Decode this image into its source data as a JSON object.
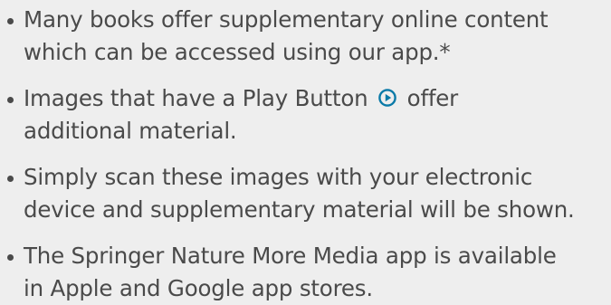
{
  "bullets": [
    {
      "line1": "Many books offer supplementary online content",
      "line2": "which can be accessed using our app.*"
    },
    {
      "line1_before_icon": "Images that have a Play Button",
      "line1_after_icon": "offer",
      "line2": "additional material.",
      "icon": "play-circle-icon",
      "icon_color": "#0a7aa8"
    },
    {
      "line1": "Simply scan these images with your electronic",
      "line2": "device and supplementary material will be shown."
    },
    {
      "line1": "The Springer Nature More Media app is available",
      "line2": "in Apple and Google app stores."
    }
  ]
}
